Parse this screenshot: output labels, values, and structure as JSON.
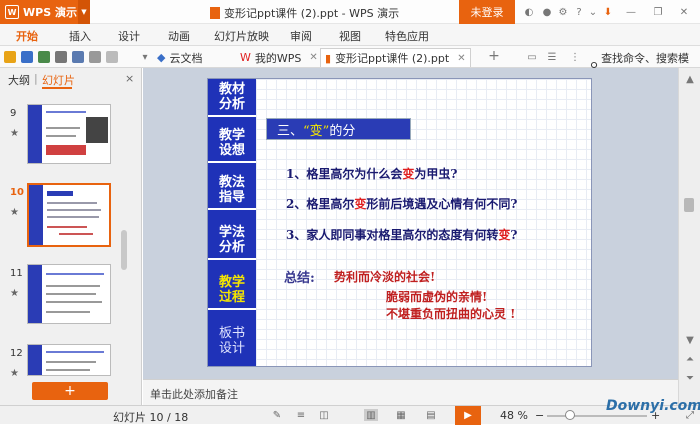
{
  "titlebar": {
    "app_name": "WPS 演示",
    "window_title": "变形记ppt课件 (2).ppt - WPS 演示",
    "login_label": "未登录",
    "icons": [
      "skin-icon",
      "feedback-icon",
      "settings-icon",
      "help-icon",
      "minimize-icon",
      "save-cloud-icon",
      "window-minimize-icon",
      "window-restore-icon",
      "window-close-icon"
    ]
  },
  "ribbon": {
    "tabs": [
      "开始",
      "插入",
      "设计",
      "动画",
      "幻灯片放映",
      "审阅",
      "视图",
      "特色应用"
    ],
    "active_tab": "开始"
  },
  "toolbar": {
    "doc_tabs": [
      {
        "label": "云文档"
      },
      {
        "label": "我的WPS"
      },
      {
        "label": "变形记ppt课件 (2).ppt"
      }
    ],
    "add_tab": "+",
    "search_placeholder": "查找命令、搜索模板"
  },
  "left_panel": {
    "tabs": [
      "大纲",
      "幻灯片"
    ],
    "active_tab": "幻灯片",
    "close": "×",
    "slides": [
      {
        "num": "9"
      },
      {
        "num": "10"
      },
      {
        "num": "11"
      },
      {
        "num": "12"
      }
    ],
    "selected_slide": "10",
    "add_slide": "+"
  },
  "slide": {
    "nav": [
      {
        "label": "教材\n分析"
      },
      {
        "label": "教学\n设想"
      },
      {
        "label": "教法\n指导"
      },
      {
        "label": "学法\n分析"
      },
      {
        "label": "教学\n过程"
      },
      {
        "label": "板书\n设计"
      }
    ],
    "title_prefix": "三、",
    "title_quote": "“变”",
    "title_suffix": "的分",
    "questions": [
      {
        "pre": "1、格里高尔为什么会",
        "hl": "变",
        "post": "为甲虫?"
      },
      {
        "pre": "2、格里高尔",
        "hl": "变",
        "post": "形前后境遇及心情有何不同?"
      },
      {
        "pre": "3、家人即同事对格里高尔的态度有何转",
        "hl": "变",
        "post": "?"
      }
    ],
    "summary_label": "总结:",
    "summary_lines": [
      "势利而冷淡的社会!",
      "脆弱而虚伪的亲情!",
      "不堪重负而扭曲的心灵 !"
    ]
  },
  "notes": {
    "placeholder": "单击此处添加备注"
  },
  "statusbar": {
    "slide_info": "幻灯片 10 / 18",
    "zoom": "48 %",
    "zoom_minus": "−",
    "zoom_plus": "+"
  },
  "watermark": "Downyi.com",
  "colors": {
    "accent": "#e8630f",
    "slide_blue": "#1f32b8",
    "highlight_red": "#e02020"
  }
}
